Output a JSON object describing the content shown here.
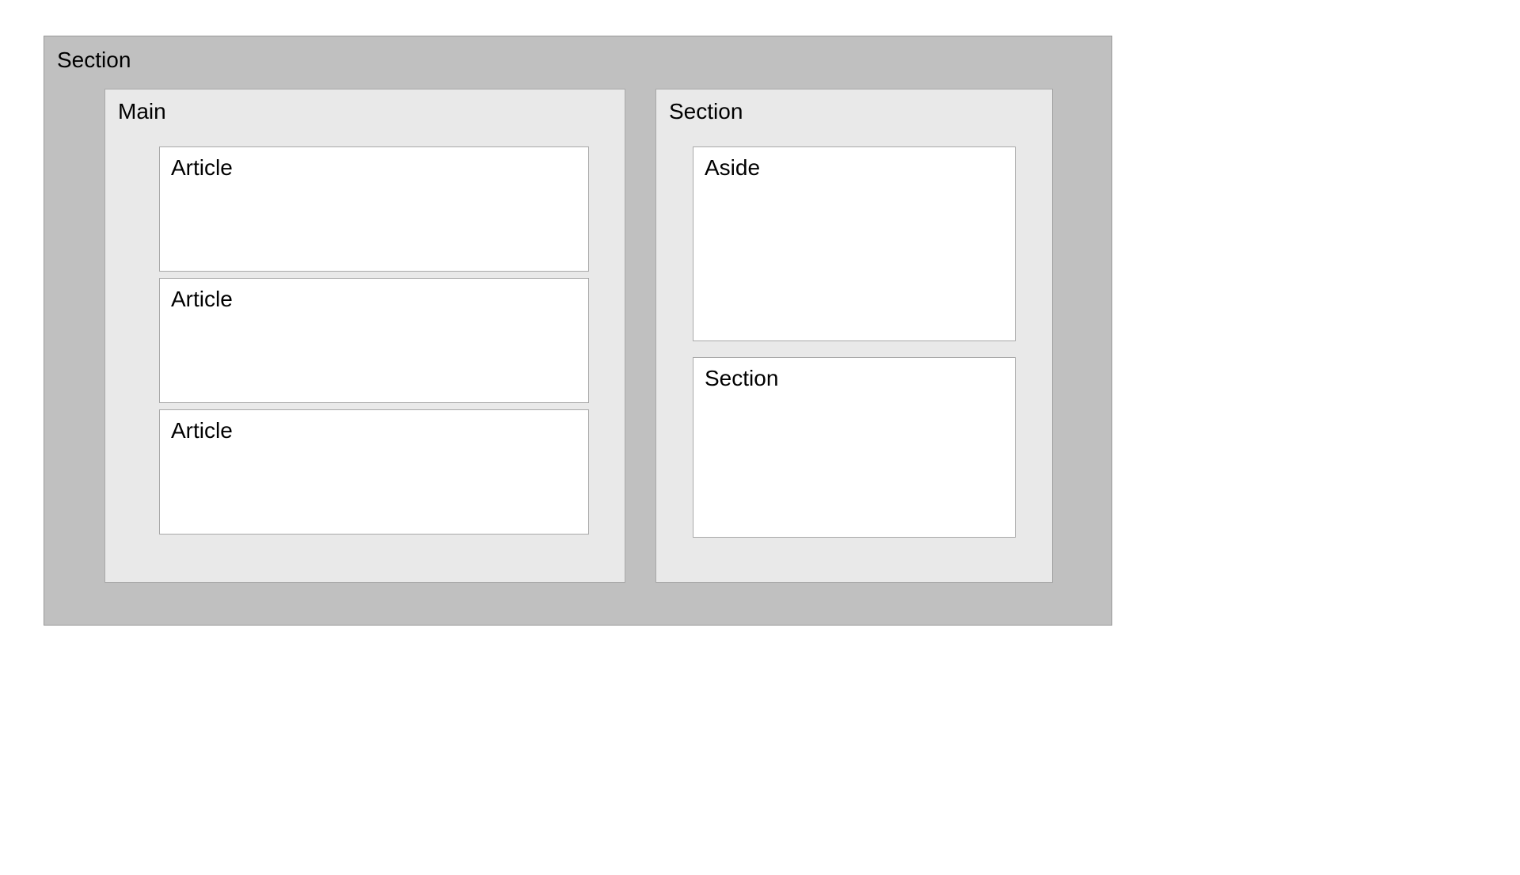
{
  "outer": {
    "label": "Section"
  },
  "main": {
    "label": "Main",
    "articles": [
      {
        "label": "Article"
      },
      {
        "label": "Article"
      },
      {
        "label": "Article"
      }
    ]
  },
  "right": {
    "label": "Section",
    "aside": {
      "label": "Aside"
    },
    "innerSection": {
      "label": "Section"
    }
  }
}
